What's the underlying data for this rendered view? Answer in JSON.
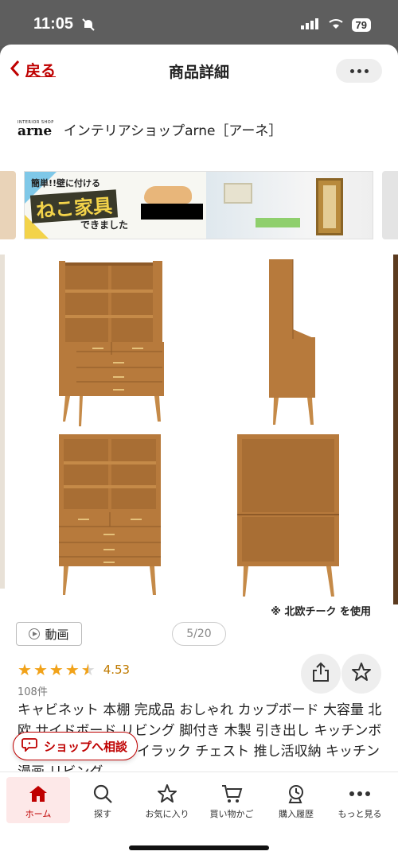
{
  "status_bar": {
    "time": "11:05",
    "battery": "79"
  },
  "header": {
    "back_label": "戻る",
    "title": "商品詳細"
  },
  "shop": {
    "logo_small": "INTERIOR SHOP",
    "logo_main": "arne",
    "name": "インテリアショップarne［アーネ］"
  },
  "banner": {
    "headline": "簡単!!壁に付ける",
    "title": "ねこ家具",
    "subtitle": "できました"
  },
  "gallery": {
    "note": "※ 北欧チーク を使用",
    "current_page": "5/20"
  },
  "video_button": {
    "label": "動画"
  },
  "rating": {
    "value": "4.53",
    "stars": 4.5,
    "review_count": "108件"
  },
  "product": {
    "title": "キャビネット 本棚 完成品 おしゃれ カップボード 大容量 北欧 サイドボード リビング 脚付き 木製 引き出し キッチンボード a4 ディスプレイラック チェスト 推し活収納 キッチン 漫画 リビング"
  },
  "floating": {
    "shop_consult": "ショップへ相談"
  },
  "bottom_nav": {
    "items": [
      {
        "label": "ホーム",
        "icon": "home-icon",
        "active": true
      },
      {
        "label": "探す",
        "icon": "search-icon",
        "active": false
      },
      {
        "label": "お気に入り",
        "icon": "star-icon",
        "active": false
      },
      {
        "label": "買い物かご",
        "icon": "cart-icon",
        "active": false
      },
      {
        "label": "購入履歴",
        "icon": "history-icon",
        "active": false
      },
      {
        "label": "もっと見る",
        "icon": "more-icon",
        "active": false
      }
    ]
  },
  "colors": {
    "brand_red": "#bf0000",
    "star": "#f1a219",
    "wood": "#b77a3c"
  }
}
